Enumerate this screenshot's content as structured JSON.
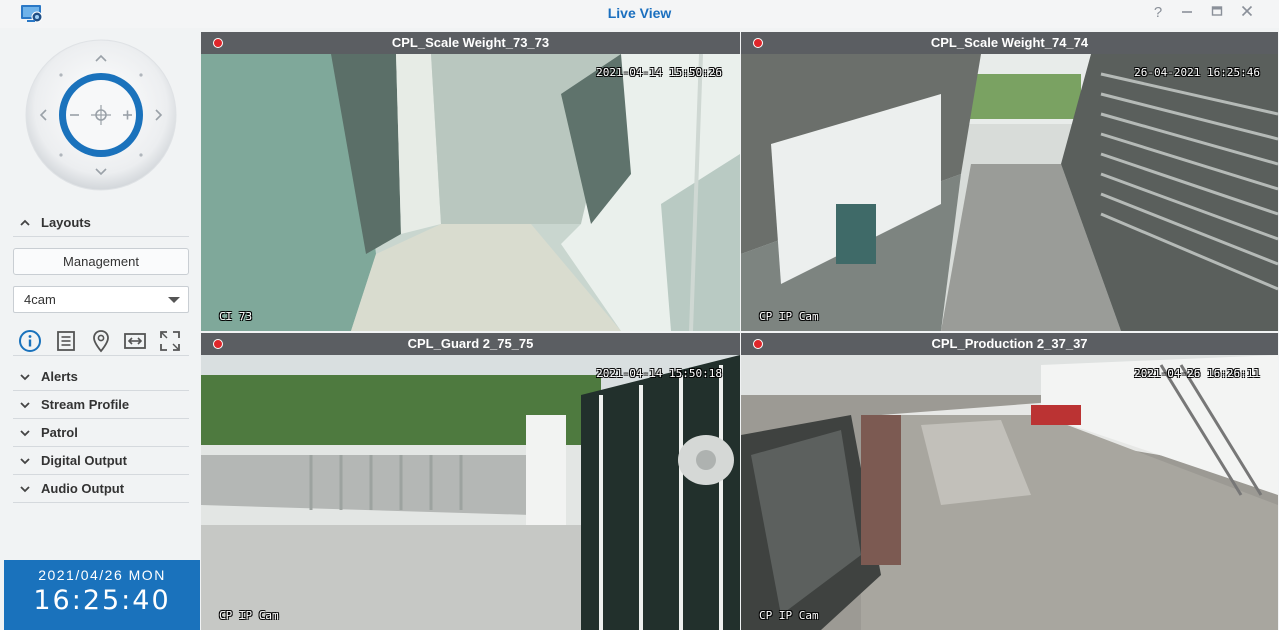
{
  "window": {
    "title": "Live View",
    "controls": [
      "help-icon",
      "minimize-icon",
      "maximize-icon",
      "close-icon"
    ]
  },
  "sidebar": {
    "sections": {
      "layouts": "Layouts",
      "alerts": "Alerts",
      "stream_profile": "Stream Profile",
      "patrol": "Patrol",
      "digital_output": "Digital Output",
      "audio_output": "Audio Output"
    },
    "management_label": "Management",
    "layout_selected": "4cam",
    "tools": [
      "info-icon",
      "list-icon",
      "location-icon",
      "swap-icon",
      "fullscreen-icon"
    ]
  },
  "clock": {
    "date": "2021/04/26 MON",
    "time": "16:25:40"
  },
  "cameras": [
    {
      "name": "CPL_Scale Weight_73_73",
      "timestamp": "2021-04-14 15:50:26",
      "label": "CI 73",
      "selected": true
    },
    {
      "name": "CPL_Scale Weight_74_74",
      "timestamp": "26-04-2021 16:25:46",
      "label": "CP IP Cam",
      "selected": false
    },
    {
      "name": "CPL_Guard 2_75_75",
      "timestamp": "2021-04-14 15:50:18",
      "label": "CP IP Cam",
      "selected": false
    },
    {
      "name": "CPL_Production 2_37_37",
      "timestamp": "2021-04-26 16:26:11",
      "label": "CP IP Cam",
      "selected": false
    }
  ],
  "colors": {
    "accent": "#1a72bc",
    "title": "#1a6fbf",
    "selection": "#e8b21a",
    "record": "#e0262a",
    "camera_header": "#5b5e62"
  }
}
